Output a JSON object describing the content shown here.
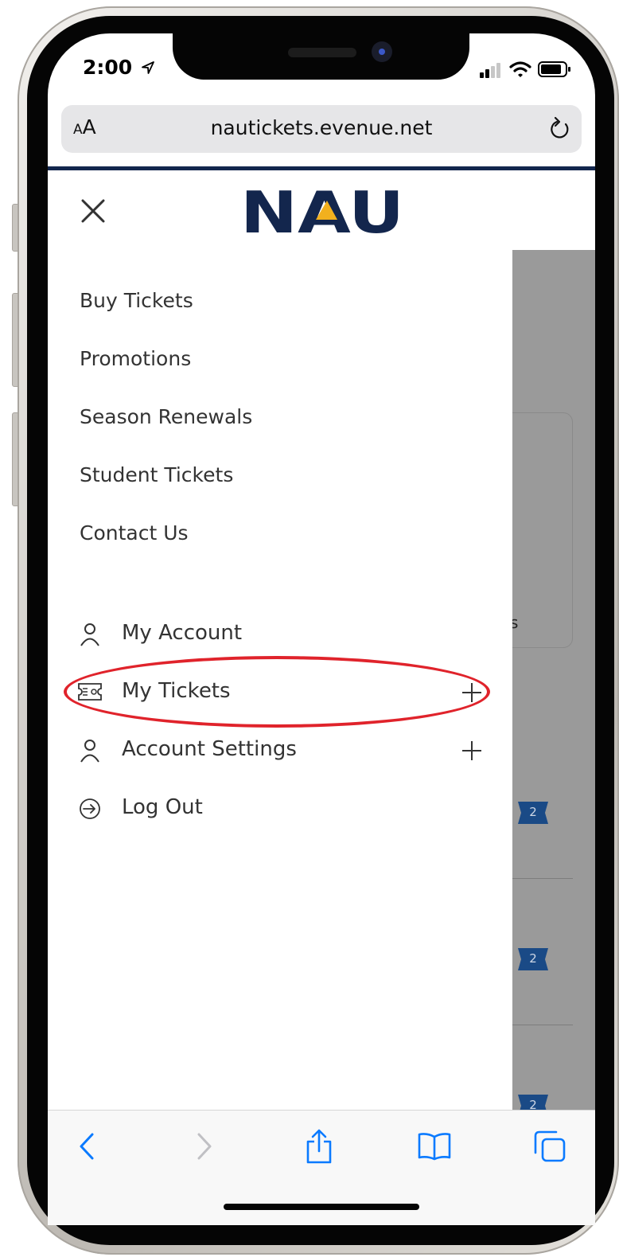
{
  "status_bar": {
    "time": "2:00"
  },
  "browser": {
    "text_size_label_small": "A",
    "text_size_label_large": "A",
    "url": "nautickets.evenue.net"
  },
  "logo_text": "NAU",
  "menu": {
    "links": [
      "Buy Tickets",
      "Promotions",
      "Season Renewals",
      "Student Tickets",
      "Contact Us"
    ],
    "account": {
      "my_account": "My Account",
      "my_tickets": "My Tickets",
      "account_settings": "Account Settings",
      "log_out": "Log Out"
    }
  },
  "background_page": {
    "partial_text": "s",
    "ticket_badges": [
      "2",
      "2",
      "2"
    ]
  },
  "colors": {
    "brand_navy": "#13264d",
    "brand_gold": "#f2b01e",
    "highlight_red": "#e0232b",
    "safari_blue": "#0a7aff"
  },
  "icons": {
    "close": "close-icon",
    "user": "user-icon",
    "ticket": "ticket-icon",
    "expand": "plus-icon",
    "logout": "logout-icon",
    "back": "chevron-left-icon",
    "forward": "chevron-right-icon",
    "share": "share-icon",
    "bookmarks": "book-icon",
    "tabs": "tabs-icon",
    "reload": "reload-icon"
  }
}
